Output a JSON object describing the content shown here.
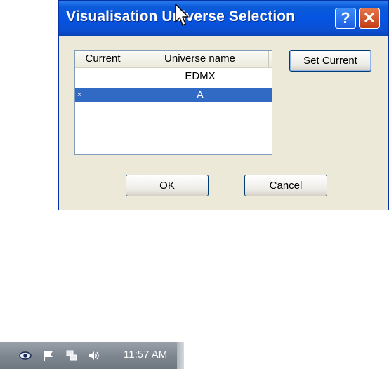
{
  "dialog": {
    "title": "Visualisation Universe Selection",
    "help_label": "?",
    "close_label": "✕",
    "list": {
      "columns": [
        "Current",
        "Universe name"
      ],
      "rows": [
        {
          "current": "",
          "name": "EDMX",
          "selected": false
        },
        {
          "current": "×",
          "name": "A",
          "selected": true
        }
      ]
    },
    "set_current_label": "Set Current",
    "ok_label": "OK",
    "cancel_label": "Cancel"
  },
  "taskbar": {
    "icons": [
      "eye-icon",
      "flag-icon",
      "network-icon",
      "speaker-icon"
    ],
    "clock": "11:57 AM"
  },
  "colors": {
    "titlebar": "#0554e3",
    "selection": "#316ac5",
    "dialog_bg": "#ece9d8"
  }
}
